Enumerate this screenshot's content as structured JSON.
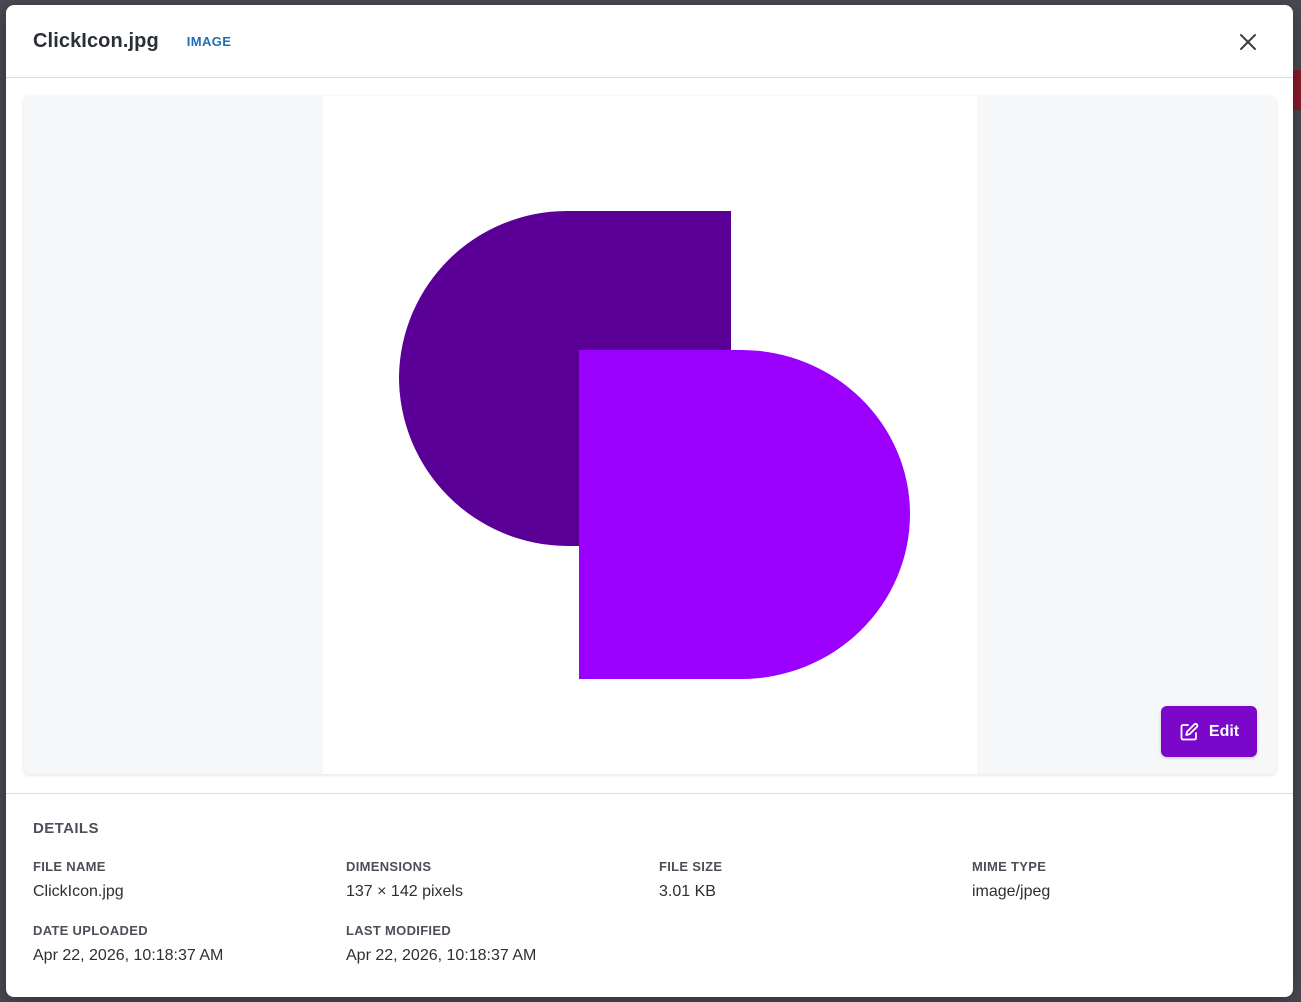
{
  "modal": {
    "title": "ClickIcon.jpg",
    "type_badge": "IMAGE"
  },
  "preview": {
    "edit_label": "Edit",
    "colors": {
      "dark_shape": "#5a0096",
      "light_shape": "#9b00ff",
      "edit_button": "#7a07c9"
    }
  },
  "details": {
    "heading": "DETAILS",
    "fields": [
      {
        "label": "FILE NAME",
        "value": "ClickIcon.jpg"
      },
      {
        "label": "DIMENSIONS",
        "value": "137 × 142 pixels"
      },
      {
        "label": "FILE SIZE",
        "value": "3.01 KB"
      },
      {
        "label": "MIME TYPE",
        "value": "image/jpeg"
      },
      {
        "label": "DATE UPLOADED",
        "value": "Apr 22, 2026, 10:18:37 AM"
      },
      {
        "label": "LAST MODIFIED",
        "value": "Apr 22, 2026, 10:18:37 AM"
      }
    ]
  }
}
